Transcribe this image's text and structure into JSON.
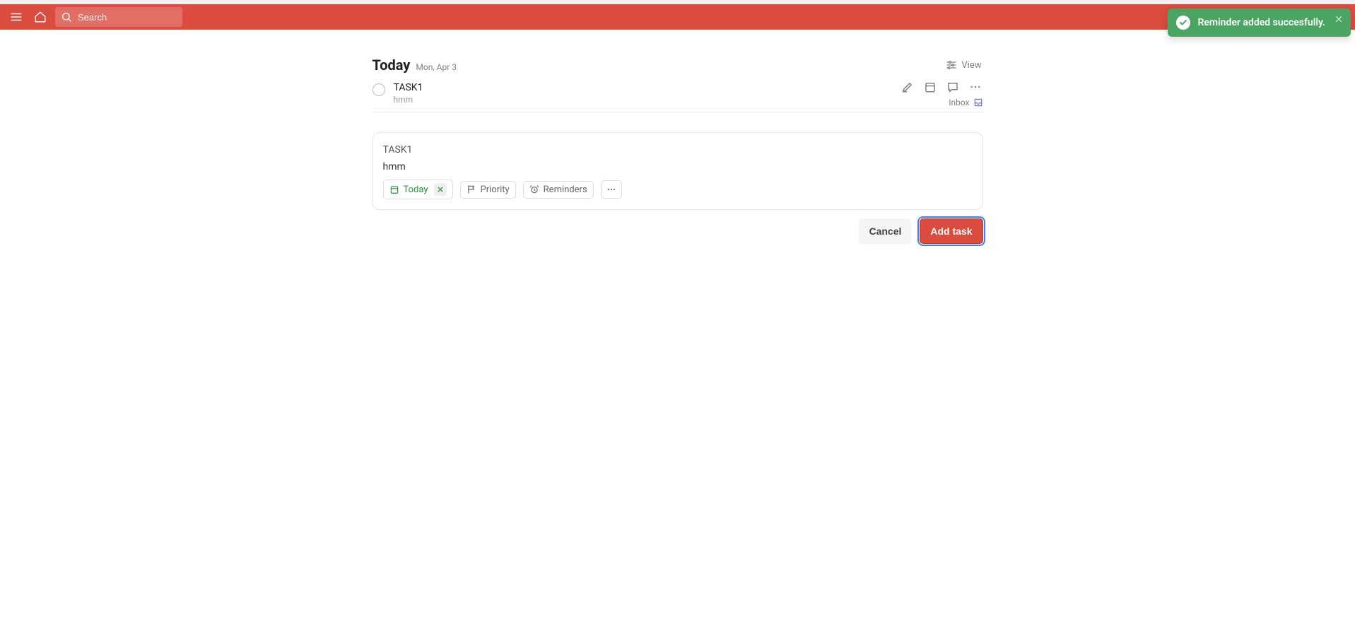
{
  "colors": {
    "brand": "#db4c3f",
    "toast_bg": "#4aa563",
    "focus_ring": "#3b82f6",
    "chip_green": "#299438"
  },
  "header": {
    "search_placeholder": "Search"
  },
  "toast": {
    "message": "Reminder added succesfully."
  },
  "page": {
    "title": "Today",
    "date": "Mon, Apr 3",
    "view_label": "View"
  },
  "task": {
    "title": "TASK1",
    "description": "hmm",
    "project": "Inbox"
  },
  "editor": {
    "title": "TASK1",
    "description": "hmm",
    "due_label": "Today",
    "priority_label": "Priority",
    "reminders_label": "Reminders",
    "cancel_label": "Cancel",
    "add_label": "Add task"
  }
}
